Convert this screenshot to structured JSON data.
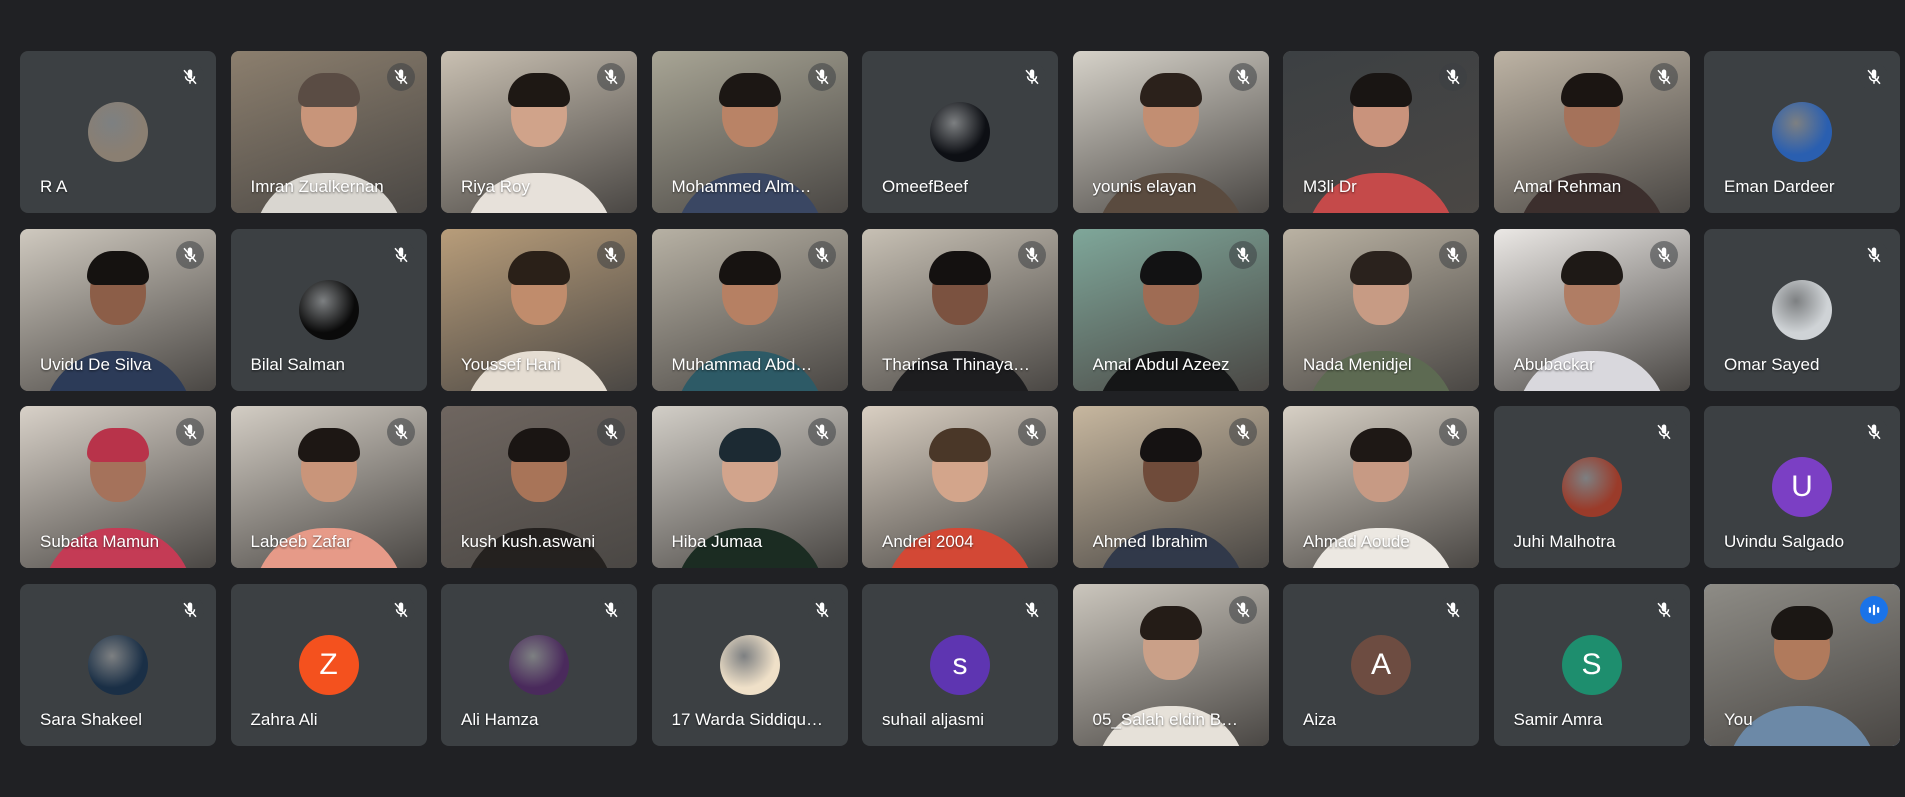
{
  "participants": [
    {
      "name": "R A",
      "mode": "avatar-image",
      "color": "#8a7f72",
      "mic": "muted"
    },
    {
      "name": "Imran Zualkernan",
      "mode": "video",
      "bg": "#8c7f6e",
      "skin": "#c8957a",
      "hair": "#5a4c44",
      "shirt": "#d9d6d0",
      "mic": "muted"
    },
    {
      "name": "Riya Roy",
      "mode": "video",
      "bg": "#c9c0b2",
      "skin": "#d0a38a",
      "hair": "#1e1814",
      "shirt": "#e7e1da",
      "mic": "muted"
    },
    {
      "name": "Mohammed Alm…",
      "mode": "video",
      "bg": "#a8a595",
      "skin": "#b98366",
      "hair": "#1c1714",
      "shirt": "#3a4763",
      "mic": "muted"
    },
    {
      "name": "OmeefBeef",
      "mode": "avatar-image",
      "color": "#0d0f14",
      "mic": "muted"
    },
    {
      "name": "younis elayan",
      "mode": "video",
      "bg": "#d6d2c9",
      "skin": "#c28e72",
      "hair": "#2b211b",
      "shirt": "#5a4b3f",
      "mic": "muted"
    },
    {
      "name": "M3li Dr",
      "mode": "video",
      "bg": "#3c4043",
      "skin": "#c9937c",
      "hair": "#191513",
      "shirt": "#c54a4a",
      "mic": "muted"
    },
    {
      "name": "Amal Rehman",
      "mode": "video",
      "bg": "#bdb3a4",
      "skin": "#a5725a",
      "hair": "#1b1512",
      "shirt": "#3c2f2d",
      "mic": "muted"
    },
    {
      "name": "Eman Dardeer",
      "mode": "avatar-image",
      "color": "#2a5fb0",
      "mic": "muted"
    },
    {
      "name": "Uvidu De Silva",
      "mode": "video",
      "bg": "#cfc9bf",
      "skin": "#8c5e48",
      "hair": "#151210",
      "shirt": "#2c3b58",
      "mic": "muted"
    },
    {
      "name": "Bilal Salman",
      "mode": "avatar-image",
      "color": "#0a0a0a",
      "mic": "muted"
    },
    {
      "name": "Youssef Hani",
      "mode": "video",
      "bg": "#b89d7a",
      "skin": "#c08c6c",
      "hair": "#2a2018",
      "shirt": "#e5ddd2",
      "mic": "muted"
    },
    {
      "name": "Muhammad Abd…",
      "mode": "video",
      "bg": "#b7b1a4",
      "skin": "#b68063",
      "hair": "#171311",
      "shirt": "#2d5a66",
      "mic": "muted"
    },
    {
      "name": "Tharinsa Thinaya…",
      "mode": "video",
      "bg": "#c7c0b4",
      "skin": "#7b5240",
      "hair": "#141110",
      "shirt": "#1d1d1f",
      "mic": "muted"
    },
    {
      "name": "Amal Abdul Azeez",
      "mode": "video",
      "bg": "#7fa79a",
      "skin": "#9f6c54",
      "hair": "#121213",
      "shirt": "#151617",
      "mic": "muted"
    },
    {
      "name": "Nada Menidjel",
      "mode": "video",
      "bg": "#bab2a3",
      "skin": "#c79b84",
      "hair": "#2a221d",
      "shirt": "#5d6a52",
      "mic": "muted"
    },
    {
      "name": "Abubackar",
      "mode": "video",
      "bg": "#ebe8e5",
      "skin": "#b07d64",
      "hair": "#1e1916",
      "shirt": "#d9d8dd",
      "mic": "muted"
    },
    {
      "name": "Omar Sayed",
      "mode": "avatar-image",
      "color": "#cfd3d6",
      "mic": "muted"
    },
    {
      "name": "Subaita Mamun",
      "mode": "video",
      "bg": "#d8d1c8",
      "skin": "#a5725b",
      "hair": "#b8334a",
      "shirt": "#c43b55",
      "mic": "muted"
    },
    {
      "name": "Labeeb Zafar",
      "mode": "video",
      "bg": "#d3cdc4",
      "skin": "#c9957a",
      "hair": "#1d1714",
      "shirt": "#e69a88",
      "mic": "muted"
    },
    {
      "name": "kush kush.aswani",
      "mode": "video",
      "bg": "#6f6660",
      "skin": "#a87458",
      "hair": "#1a1513",
      "shirt": "#24211f",
      "mic": "muted"
    },
    {
      "name": "Hiba Jumaa",
      "mode": "video",
      "bg": "#d2cec7",
      "skin": "#d2a48c",
      "hair": "#1c2a33",
      "shirt": "#1b2c22",
      "mic": "muted"
    },
    {
      "name": "Andrei 2004",
      "mode": "video",
      "bg": "#d9cfc2",
      "skin": "#d3a58b",
      "hair": "#4a3728",
      "shirt": "#d34835",
      "mic": "muted"
    },
    {
      "name": "Ahmed Ibrahim",
      "mode": "video",
      "bg": "#c7b79f",
      "skin": "#6f4b3a",
      "hair": "#151212",
      "shirt": "#31394a",
      "mic": "muted"
    },
    {
      "name": "Ahmad Aoude",
      "mode": "video",
      "bg": "#d7d0c5",
      "skin": "#c79a84",
      "hair": "#1e1815",
      "shirt": "#ece8e2",
      "mic": "muted"
    },
    {
      "name": "Juhi Malhotra",
      "mode": "avatar-image",
      "color": "#9a3b2a",
      "mic": "muted"
    },
    {
      "name": "Uvindu Salgado",
      "mode": "avatar-letter",
      "letter": "U",
      "color": "#7b3fc4",
      "mic": "muted"
    },
    {
      "name": "Sara Shakeel",
      "mode": "avatar-image",
      "color": "#1a2f46",
      "mic": "muted"
    },
    {
      "name": "Zahra Ali",
      "mode": "avatar-letter",
      "letter": "Z",
      "color": "#f4511e",
      "mic": "muted"
    },
    {
      "name": "Ali Hamza",
      "mode": "avatar-image",
      "color": "#4a2a5c",
      "mic": "muted"
    },
    {
      "name": "17 Warda Siddiqu…",
      "mode": "avatar-image",
      "color": "#efe0c8",
      "mic": "muted"
    },
    {
      "name": "suhail aljasmi",
      "mode": "avatar-letter",
      "letter": "s",
      "color": "#5e35b1",
      "mic": "muted"
    },
    {
      "name": "05_Salah eldin B…",
      "mode": "video",
      "bg": "#cbc6bd",
      "skin": "#caa088",
      "hair": "#241c17",
      "shirt": "#e6e1d9",
      "mic": "muted"
    },
    {
      "name": "Aiza",
      "mode": "avatar-letter",
      "letter": "A",
      "color": "#6d4c41",
      "mic": "muted"
    },
    {
      "name": "Samir Amra",
      "mode": "avatar-letter",
      "letter": "S",
      "color": "#1e8e6e",
      "mic": "muted"
    },
    {
      "name": "You",
      "mode": "video",
      "self": true,
      "bg": "#8e8c86",
      "skin": "#b07a5c",
      "hair": "#1b1714",
      "shirt": "#6c89a7",
      "mic": "speaking"
    }
  ]
}
